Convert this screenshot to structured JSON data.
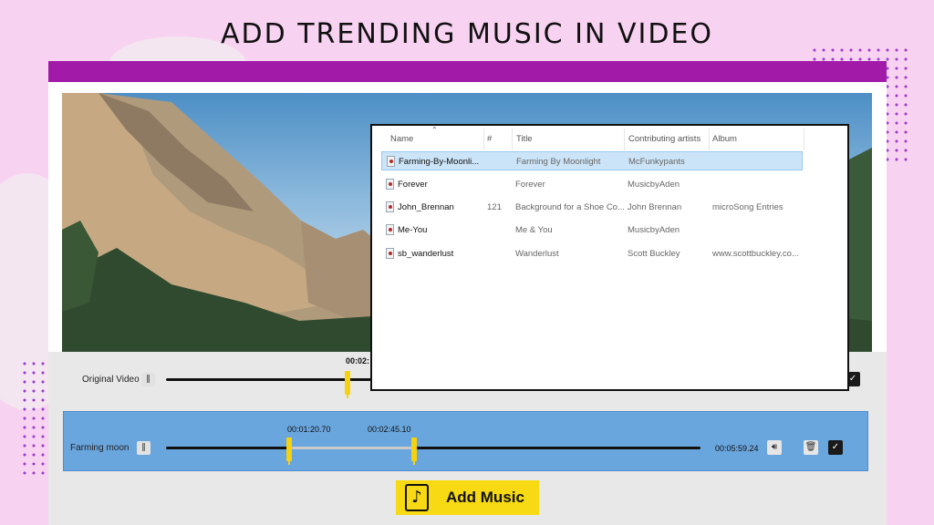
{
  "headline": "ADD TRENDING MUSIC IN VIDEO",
  "colors": {
    "brand_bar": "#a11aa8",
    "music_track": "#6aa6de",
    "handle": "#f6d10e",
    "add_music_bg": "#f7da14"
  },
  "original_track": {
    "label": "Original Video",
    "pause_icon": "pause-icon",
    "marker_time": "00:02:"
  },
  "music_track": {
    "label": "Farming moon",
    "pause_icon": "pause-icon",
    "start_time": "00:01:20.70",
    "end_time": "00:02:45.10",
    "duration": "00:05:59.24",
    "volume_icon": "speaker-icon",
    "delete_icon": "trash-icon",
    "confirm_icon": "checkmark-icon"
  },
  "add_music_button": {
    "label": "Add Music",
    "icon": "music-note-add-icon"
  },
  "file_list": {
    "columns": {
      "name": "Name",
      "number": "#",
      "title": "Title",
      "artists": "Contributing artists",
      "album": "Album"
    },
    "rows": [
      {
        "name": "Farming-By-Moonli...",
        "number": "",
        "title": "Farming By Moonlight",
        "artists": "McFunkypants",
        "album": ""
      },
      {
        "name": "Forever",
        "number": "",
        "title": "Forever",
        "artists": "MusicbyAden",
        "album": ""
      },
      {
        "name": "John_Brennan",
        "number": "121",
        "title": "Background for a Shoe Co...",
        "artists": "John Brennan",
        "album": "microSong Entries"
      },
      {
        "name": "Me-You",
        "number": "",
        "title": "Me & You",
        "artists": "MusicbyAden",
        "album": ""
      },
      {
        "name": "sb_wanderlust",
        "number": "",
        "title": "Wanderlust",
        "artists": "Scott Buckley",
        "album": "www.scottbuckley.co..."
      }
    ]
  }
}
